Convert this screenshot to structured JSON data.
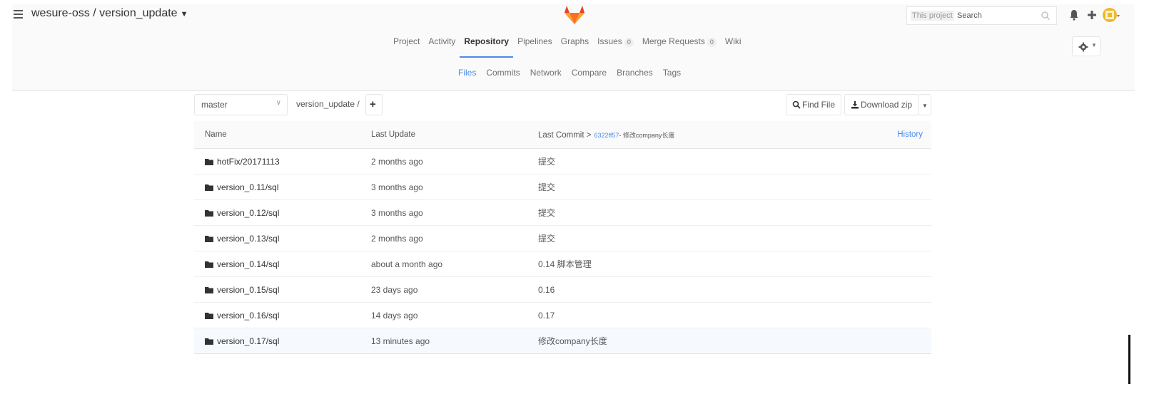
{
  "header": {
    "project_path": "wesure-oss / version_update",
    "search_scope": "This project",
    "search_placeholder": "Search"
  },
  "project_nav": [
    {
      "label": "Project"
    },
    {
      "label": "Activity"
    },
    {
      "label": "Repository",
      "active": true
    },
    {
      "label": "Pipelines"
    },
    {
      "label": "Graphs"
    },
    {
      "label": "Issues",
      "badge": "0"
    },
    {
      "label": "Merge Requests",
      "badge": "0"
    },
    {
      "label": "Wiki"
    }
  ],
  "repo_nav": [
    {
      "label": "Files",
      "active": true
    },
    {
      "label": "Commits"
    },
    {
      "label": "Network"
    },
    {
      "label": "Compare"
    },
    {
      "label": "Branches"
    },
    {
      "label": "Tags"
    }
  ],
  "toolbar": {
    "branch": "master",
    "path": "version_update /",
    "find_file": "Find File",
    "download_zip": "Download zip"
  },
  "table": {
    "headers": {
      "name": "Name",
      "last_update": "Last Update",
      "last_commit_label": "Last Commit >",
      "last_commit_hash": "6322ff57",
      "last_commit_message": "- 修改company长度",
      "history": "History"
    },
    "rows": [
      {
        "name": "hotFix/20171113",
        "last_update": "2 months ago",
        "commit": "提交"
      },
      {
        "name": "version_0.11/sql",
        "last_update": "3 months ago",
        "commit": "提交"
      },
      {
        "name": "version_0.12/sql",
        "last_update": "3 months ago",
        "commit": "提交"
      },
      {
        "name": "version_0.13/sql",
        "last_update": "2 months ago",
        "commit": "提交"
      },
      {
        "name": "version_0.14/sql",
        "last_update": "about a month ago",
        "commit": "0.14 脚本管理"
      },
      {
        "name": "version_0.15/sql",
        "last_update": "23 days ago",
        "commit": "0.16"
      },
      {
        "name": "version_0.16/sql",
        "last_update": "14 days ago",
        "commit": "0.17"
      },
      {
        "name": "version_0.17/sql",
        "last_update": "13 minutes ago",
        "commit": "修改company长度"
      }
    ]
  },
  "colors": {
    "accent": "#4a8bee",
    "logo_orange": "#e24329",
    "avatar": "#f2b632"
  }
}
